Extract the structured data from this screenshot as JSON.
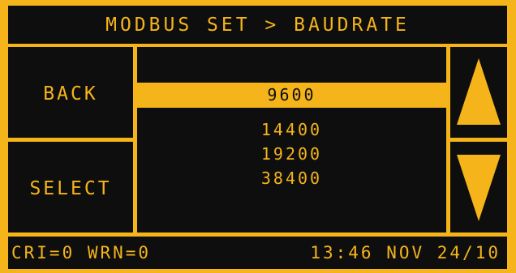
{
  "header": {
    "title": "MODBUS SET > BAUDRATE"
  },
  "buttons": {
    "back": "BACK",
    "select": "SELECT"
  },
  "list": {
    "items": [
      "9600",
      "14400",
      "19200",
      "38400"
    ],
    "selected_index": 0
  },
  "scroll": {
    "up_icon": "arrow-up-icon",
    "down_icon": "arrow-down-icon"
  },
  "status": {
    "alarms": "CRI=0 WRN=0",
    "datetime": "13:46 NOV 24/10"
  },
  "colors": {
    "accent": "#f5b41a",
    "background": "#0e0e0e"
  }
}
